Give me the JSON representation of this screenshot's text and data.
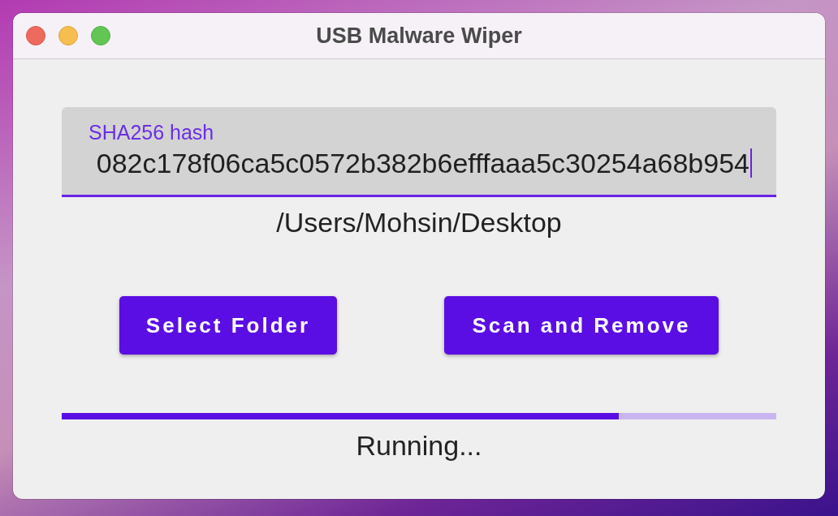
{
  "window": {
    "title": "USB Malware Wiper"
  },
  "hash_field": {
    "label": "SHA256 hash",
    "value": "082c178f06ca5c0572b382b6efffaaa5c30254a68b954",
    "focused": true
  },
  "folder_path": "/Users/Mohsin/Desktop",
  "buttons": [
    {
      "label": "Select Folder"
    },
    {
      "label": "Scan and Remove"
    }
  ],
  "progress": {
    "level": 0.78
  },
  "status": "Running..."
}
